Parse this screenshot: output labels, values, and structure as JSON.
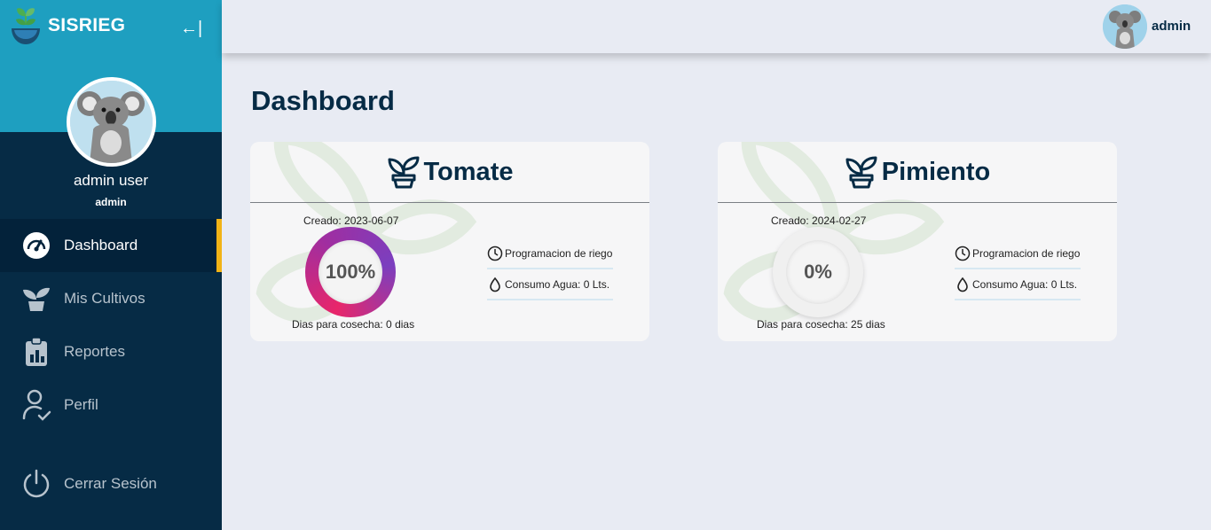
{
  "app": {
    "name": "SISRIEG",
    "collapse_glyph": "←|"
  },
  "sidebar": {
    "user_name": "admin user",
    "user_role": "admin",
    "items": [
      {
        "label": "Dashboard",
        "icon": "gauge-icon",
        "active": true
      },
      {
        "label": "Mis Cultivos",
        "icon": "sprout-icon",
        "active": false
      },
      {
        "label": "Reportes",
        "icon": "clipboard-chart-icon",
        "active": false
      },
      {
        "label": "Perfil",
        "icon": "user-check-icon",
        "active": false
      }
    ],
    "logout_label": "Cerrar Sesión"
  },
  "topbar": {
    "user_label": "admin"
  },
  "main": {
    "title": "Dashboard",
    "cards": [
      {
        "name": "Tomate",
        "created": "Creado: 2023-06-07",
        "progress_label": "100%",
        "progress": 100,
        "days_label": "Dias para cosecha: 0 dias",
        "schedule_label": "Programacion de riego",
        "water_label": "Consumo Agua: 0 Lts."
      },
      {
        "name": "Pimiento",
        "created": "Creado: 2024-02-27",
        "progress_label": "0%",
        "progress": 0,
        "days_label": "Dias para cosecha: 25 dias",
        "schedule_label": "Programacion de riego",
        "water_label": "Consumo Agua: 0 Lts."
      }
    ]
  },
  "colors": {
    "sidebar": "#062b45",
    "sidebar_top": "#1e9fc0",
    "active_marker": "#f2b316",
    "gauge_start": "#e8266a",
    "gauge_end": "#7b3fbf"
  }
}
